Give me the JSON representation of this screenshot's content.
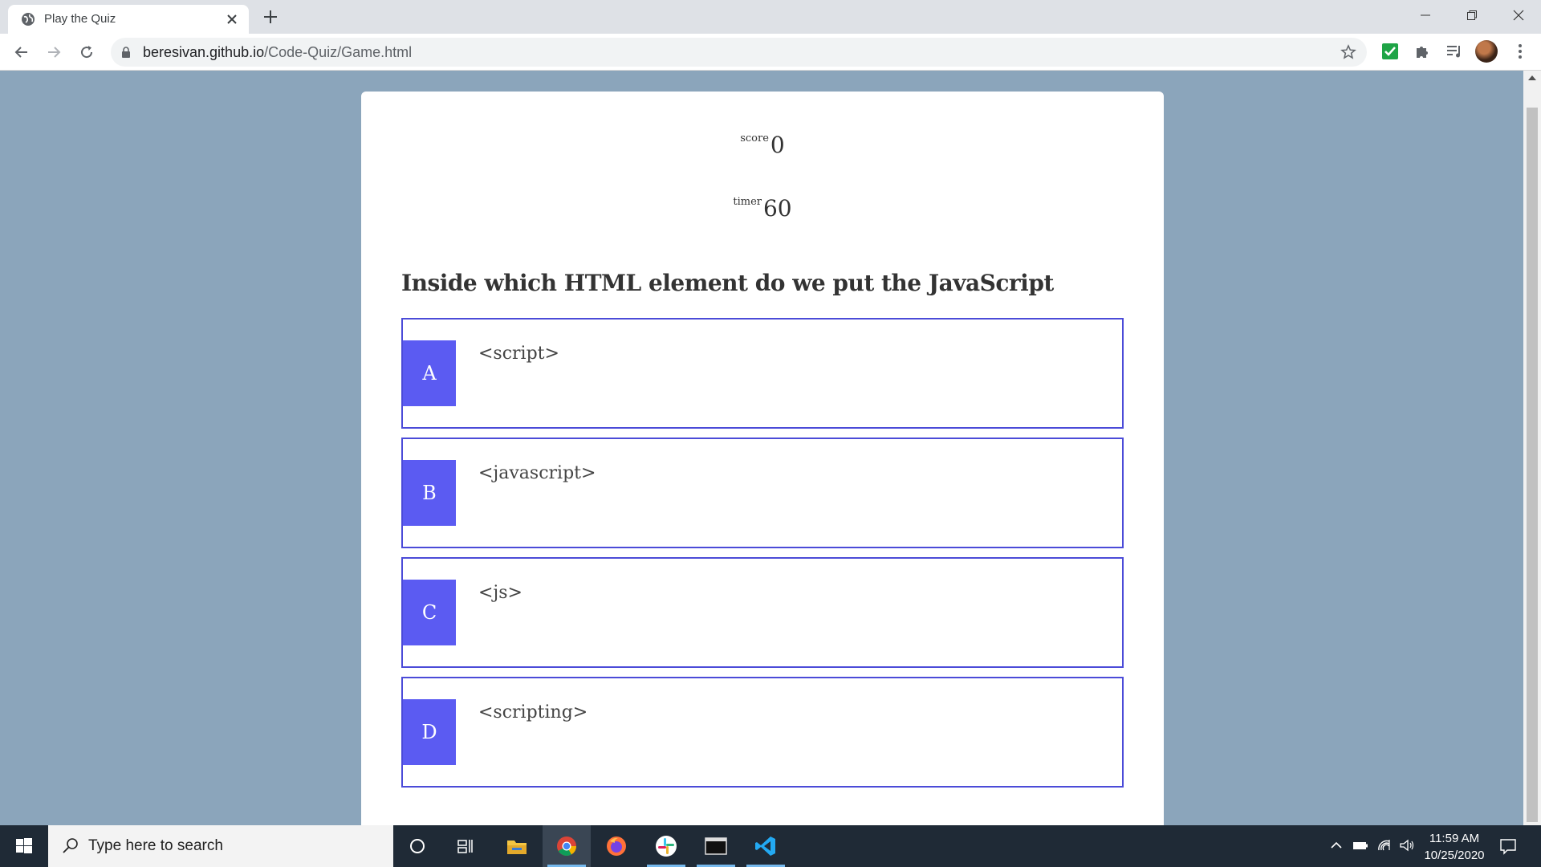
{
  "browser": {
    "tab_title": "Play the Quiz",
    "url_host": "beresivan.github.io",
    "url_path": "/Code-Quiz/Game.html"
  },
  "quiz": {
    "score_label": "score",
    "score_value": "0",
    "timer_label": "timer",
    "timer_value": "60",
    "question": "Inside which HTML element do we put the JavaScript",
    "choices": [
      {
        "prefix": "A",
        "text": "<script>"
      },
      {
        "prefix": "B",
        "text": "<javascript>"
      },
      {
        "prefix": "C",
        "text": "<js>"
      },
      {
        "prefix": "D",
        "text": "<scripting>"
      }
    ]
  },
  "taskbar": {
    "search_placeholder": "Type here to search",
    "time": "11:59 AM",
    "date": "10/25/2020"
  },
  "colors": {
    "page_background": "#8ba5bb",
    "choice_border": "#4b4bd8",
    "choice_prefix": "#5b5bf2"
  }
}
